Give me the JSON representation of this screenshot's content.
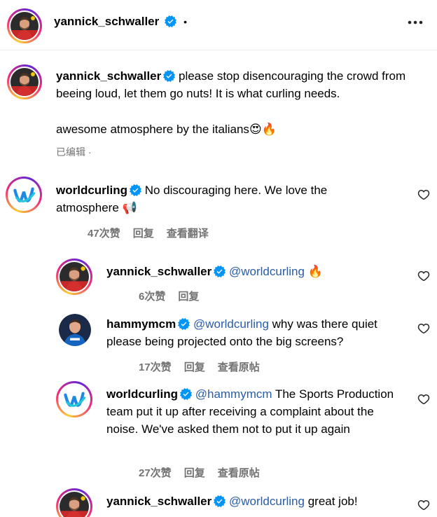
{
  "header": {
    "username": "yannick_schwaller",
    "dot": "•"
  },
  "caption": {
    "username": "yannick_schwaller",
    "text": "please stop disencouraging the crowd from beeing loud, let them go nuts! It is what curling needs.",
    "text2": "awesome atmosphere by the italians",
    "emoji": "😍🔥",
    "edited": "已编辑 ·"
  },
  "comments": [
    {
      "username": "worldcurling",
      "mention": "",
      "text": "No discouraging here. We love the atmosphere 📢",
      "likes": "47次赞",
      "reply": "回复",
      "extra": "查看翻译"
    },
    {
      "username": "yannick_schwaller",
      "mention": "@worldcurling",
      "text": "🔥",
      "likes": "6次赞",
      "reply": "回复",
      "extra": ""
    },
    {
      "username": "hammymcm",
      "mention": "@worldcurling",
      "text": "why was there quiet please being projected onto the big screens?",
      "likes": "17次赞",
      "reply": "回复",
      "extra": "查看原帖"
    },
    {
      "username": "worldcurling",
      "mention": "@hammymcm",
      "text": "The Sports Production team put it up after receiving a complaint about the noise. We've asked them not to put it up again",
      "likes": "27次赞",
      "reply": "回复",
      "extra": "查看原帖"
    },
    {
      "username": "yannick_schwaller",
      "mention": "@worldcurling",
      "text": "great job!",
      "likes": "",
      "reply": "",
      "extra": ""
    }
  ],
  "colors": {
    "verified": "#0095f6",
    "mention": "#2a5da8",
    "meta": "#737373"
  },
  "icons": {
    "more": "more-options-icon",
    "like": "heart-outline-icon",
    "verified": "verified-badge-icon"
  }
}
